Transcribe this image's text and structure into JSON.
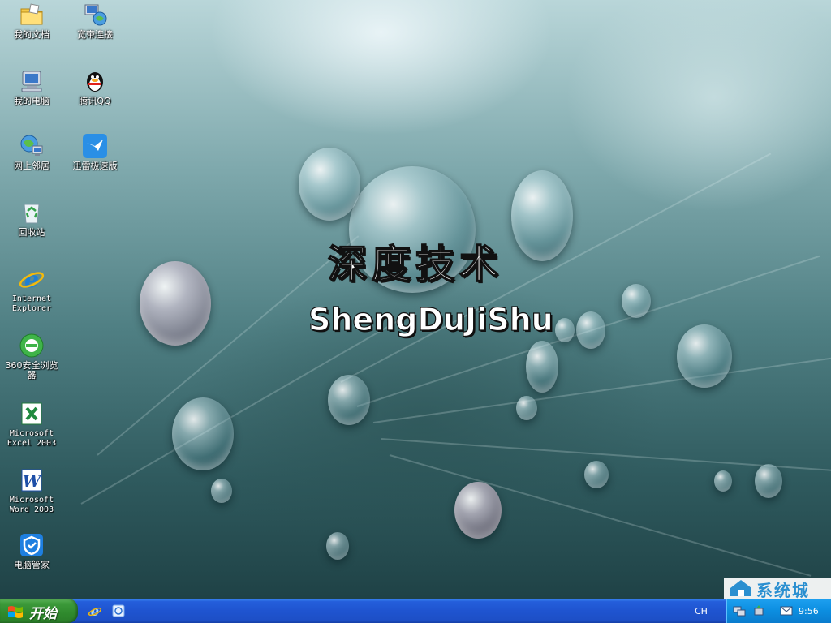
{
  "desktop": {
    "wallpaper": {
      "title": "深度技术",
      "subtitle": "ShengDuJiShu"
    },
    "icons": [
      {
        "label": "我的文档",
        "icon": "my-documents-icon"
      },
      {
        "label": "宽带连接",
        "icon": "broadband-connection-icon"
      },
      {
        "label": "我的电脑",
        "icon": "my-computer-icon"
      },
      {
        "label": "腾讯QQ",
        "icon": "qq-penguin-icon"
      },
      {
        "label": "网上邻居",
        "icon": "network-places-icon"
      },
      {
        "label": "迅雷极速版",
        "icon": "xunlei-bird-icon"
      },
      {
        "label": "回收站",
        "icon": "recycle-bin-icon"
      },
      {
        "label_lines": [
          "Internet",
          "Explorer"
        ],
        "icon": "internet-explorer-icon"
      },
      {
        "label": "360安全浏览器",
        "icon": "360-browser-icon"
      },
      {
        "label_lines": [
          "Microsoft",
          "Excel 2003"
        ],
        "icon": "excel-icon"
      },
      {
        "label_lines": [
          "Microsoft",
          "Word 2003"
        ],
        "icon": "word-icon"
      },
      {
        "label": "电脑管家",
        "icon": "pc-manager-shield-icon"
      }
    ],
    "watermark": {
      "text": "系统城",
      "url": "xitongcheng.com"
    }
  },
  "taskbar": {
    "start_label": "开始",
    "quick_launch": [
      "internet-explorer-icon",
      "browser-icon"
    ],
    "language": "CH",
    "clock": "9:56",
    "tray_icons": [
      "network-icon",
      "safely-remove-icon",
      "mail-icon"
    ]
  },
  "colors": {
    "taskbar_blue": "#245edb",
    "start_green": "#3c9a3a",
    "tray_blue": "#0c8ee0"
  }
}
